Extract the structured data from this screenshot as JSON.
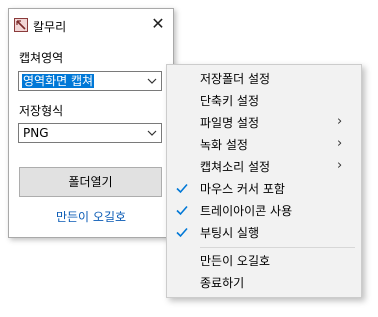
{
  "window": {
    "title": "칼무리",
    "close_glyph": "✕"
  },
  "capture_area": {
    "label": "캡쳐영역",
    "selected": "영역화면 캡쳐"
  },
  "save_format": {
    "label": "저장형식",
    "selected": "PNG"
  },
  "open_folder_button": "폴더열기",
  "author_link": "만든이 오길호",
  "menu": {
    "items": [
      {
        "label": "저장폴더 설정",
        "checked": false,
        "submenu": false
      },
      {
        "label": "단축키 설정",
        "checked": false,
        "submenu": false
      },
      {
        "label": "파일명 설정",
        "checked": false,
        "submenu": true
      },
      {
        "label": "녹화 설정",
        "checked": false,
        "submenu": true
      },
      {
        "label": "캡쳐소리 설정",
        "checked": false,
        "submenu": true
      },
      {
        "label": "마우스 커서 포함",
        "checked": true,
        "submenu": false
      },
      {
        "label": "트레이아이콘 사용",
        "checked": true,
        "submenu": false
      },
      {
        "label": "부팅시 실행",
        "checked": true,
        "submenu": false
      },
      {
        "label": "만든이 오길호",
        "checked": false,
        "submenu": false
      },
      {
        "label": "종료하기",
        "checked": false,
        "submenu": false
      }
    ],
    "submenu_glyph": "›"
  },
  "colors": {
    "selection": "#0078d7",
    "link": "#0a5bb5",
    "check": "#0078d7"
  }
}
